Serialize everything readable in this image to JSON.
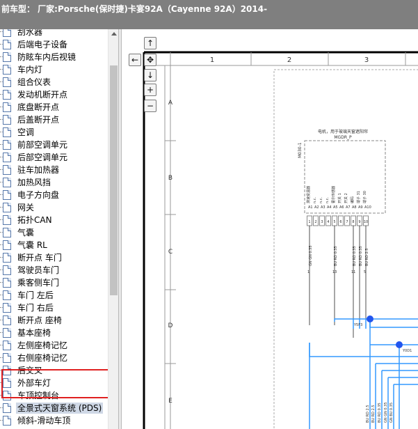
{
  "title_bar": {
    "text": "前车型：  厂家:Porsche(保时捷)卡宴92A（Cayenne 92A）2014-"
  },
  "tree": {
    "items": [
      {
        "label": "刮水器"
      },
      {
        "label": "后端电子设备"
      },
      {
        "label": "防眩车内后视镜"
      },
      {
        "label": "车内灯"
      },
      {
        "label": "组合仪表"
      },
      {
        "label": "发动机断开点"
      },
      {
        "label": "底盘断开点"
      },
      {
        "label": "后盖断开点"
      },
      {
        "label": "空调"
      },
      {
        "label": "前部空调单元"
      },
      {
        "label": "后部空调单元"
      },
      {
        "label": "驻车加热器"
      },
      {
        "label": "加热风挡"
      },
      {
        "label": "电子方向盘"
      },
      {
        "label": "网关"
      },
      {
        "label": "拓扑CAN"
      },
      {
        "label": "气囊"
      },
      {
        "label": "气囊 RL"
      },
      {
        "label": "断开点 车门"
      },
      {
        "label": "驾驶员车门"
      },
      {
        "label": "乘客侧车门"
      },
      {
        "label": "车门 左后"
      },
      {
        "label": "车门 右后"
      },
      {
        "label": "断开点 座椅"
      },
      {
        "label": "基本座椅"
      },
      {
        "label": "左侧座椅记忆"
      },
      {
        "label": "右侧座椅记忆"
      },
      {
        "label": "后交叉"
      },
      {
        "label": "外部车灯"
      },
      {
        "label": "车顶控制台"
      },
      {
        "label": "全景式天窗系统 (PDS)",
        "selected": true
      },
      {
        "label": "倾斜-滑动车顶"
      }
    ]
  },
  "nav": {
    "up": "↑",
    "left": "←",
    "center": "✥",
    "down": "↓",
    "zoom_in": "+",
    "zoom_out": "−"
  },
  "diagram": {
    "columns": [
      "1",
      "2",
      "3"
    ],
    "rows": [
      "A",
      "B",
      "C",
      "D",
      "E"
    ],
    "component_title": "电机，用于玻璃天窗遮阳帘",
    "component_code": "MGDR_P",
    "component_id": "M030-1",
    "pin_names": [
      "测速受温器",
      "n.c.",
      "n.c.",
      "n.c.",
      "霍尔传感器",
      "开关 1",
      "开关 2",
      "编码",
      "端子 31",
      "端子 30"
    ],
    "pin_ids": [
      "A1",
      "A2",
      "A3",
      "A4",
      "A5",
      "A6",
      "A7",
      "A8",
      "A9",
      "A10"
    ],
    "pin_numbers": [
      "1",
      "2",
      "3",
      "4",
      "5",
      "6",
      "7",
      "8",
      "9",
      "10"
    ],
    "wire_labels": [
      "GN GN 0.35",
      "BU RD 0.35",
      "BU RD 0.35",
      "BU RD 0.35",
      "BU RD 2.5"
    ],
    "wire_numbers": [
      "1",
      "13",
      "11",
      "5"
    ],
    "splices": [
      "Y5F3",
      "Y0D1"
    ],
    "bottom_wire_labels": [
      "BU RD 2.5",
      "BU RD 2.5",
      "BU RD 0.35",
      "GN GN 0.35",
      "GN BU 0.35"
    ]
  },
  "colors": {
    "title_bar_bg": "#7f7f7f",
    "wire": "#3399ff",
    "splice_dot": "#2255ee",
    "highlight_border": "#e02020"
  }
}
